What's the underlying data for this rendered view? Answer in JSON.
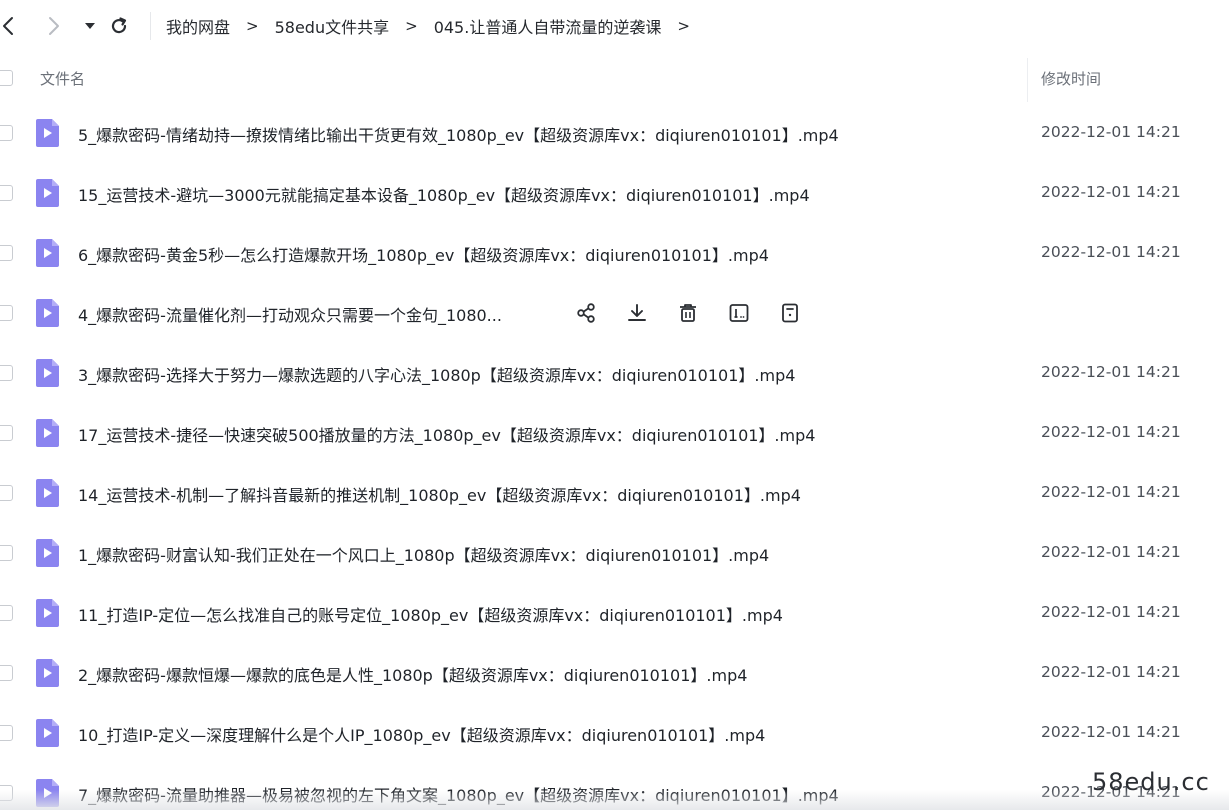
{
  "toolbar": {
    "back_icon": "chevron-left-icon",
    "forward_icon": "chevron-right-icon",
    "dropdown_icon": "caret-down-icon",
    "refresh_icon": "refresh-icon"
  },
  "breadcrumb": {
    "items": [
      "我的网盘",
      "58edu文件共享",
      "045.让普通人自带流量的逆袭课"
    ],
    "separator": ">"
  },
  "columns": {
    "name": "文件名",
    "modified": "修改时间"
  },
  "files": [
    {
      "name": "5_爆款密码-情绪劫持—撩拨情绪比输出干货更有效_1080p_ev【超级资源库vx：diqiuren010101】.mp4",
      "time": "2022-12-01 14:21"
    },
    {
      "name": "15_运营技术-避坑—3000元就能搞定基本设备_1080p_ev【超级资源库vx：diqiuren010101】.mp4",
      "time": "2022-12-01 14:21"
    },
    {
      "name": "6_爆款密码-黄金5秒—怎么打造爆款开场_1080p_ev【超级资源库vx：diqiuren010101】.mp4",
      "time": "2022-12-01 14:21"
    },
    {
      "name": "4_爆款密码-流量催化剂—打动观众只需要一个金句_1080...",
      "time": "",
      "hover": true
    },
    {
      "name": "3_爆款密码-选择大于努力—爆款选题的八字心法_1080p【超级资源库vx：diqiuren010101】.mp4",
      "time": "2022-12-01 14:21"
    },
    {
      "name": "17_运营技术-捷径—快速突破500播放量的方法_1080p_ev【超级资源库vx：diqiuren010101】.mp4",
      "time": "2022-12-01 14:21"
    },
    {
      "name": "14_运营技术-机制—了解抖音最新的推送机制_1080p_ev【超级资源库vx：diqiuren010101】.mp4",
      "time": "2022-12-01 14:21"
    },
    {
      "name": "1_爆款密码-财富认知-我们正处在一个风口上_1080p【超级资源库vx：diqiuren010101】.mp4",
      "time": "2022-12-01 14:21"
    },
    {
      "name": "11_打造IP-定位—怎么找准自己的账号定位_1080p_ev【超级资源库vx：diqiuren010101】.mp4",
      "time": "2022-12-01 14:21"
    },
    {
      "name": "2_爆款密码-爆款恒爆—爆款的底色是人性_1080p【超级资源库vx：diqiuren010101】.mp4",
      "time": "2022-12-01 14:21"
    },
    {
      "name": "10_打造IP-定义—深度理解什么是个人IP_1080p_ev【超级资源库vx：diqiuren010101】.mp4",
      "time": "2022-12-01 14:21"
    },
    {
      "name": "7_爆款密码-流量助推器—极易被忽视的左下角文案_1080p_ev【超级资源库vx：diqiuren010101】.mp4",
      "time": "2022-12-01 14:21"
    }
  ],
  "row_actions": [
    "share-icon",
    "download-icon",
    "delete-icon",
    "rename-icon",
    "more-info-icon"
  ],
  "colors": {
    "file_icon": "#8b84f0",
    "file_icon_fold": "#b3aef7"
  },
  "watermark": "58edu.cc"
}
